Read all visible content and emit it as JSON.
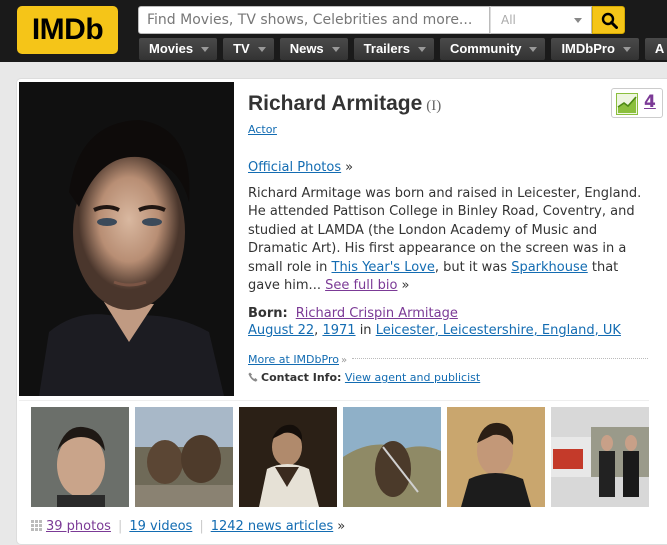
{
  "header": {
    "logo_text": "IMDb",
    "search_placeholder": "Find Movies, TV shows, Celebrities and more...",
    "search_category": "All",
    "nav": [
      "Movies",
      "TV",
      "News",
      "Trailers",
      "Community",
      "IMDbPro",
      "A"
    ]
  },
  "person": {
    "name": "Richard Armitage",
    "roman": "(I)",
    "role": "Actor",
    "meter_rank": "4",
    "official_photos": "Official Photos",
    "bio": {
      "part1": "Richard Armitage was born and raised in Leicester, England. He attended Pattison College in Binley Road, Coventry, and studied at LAMDA (the London Academy of Music and Dramatic Art). His first appearance on the screen was in a small role in ",
      "link1": "This Year's Love",
      "part2": ", but it was ",
      "link2": "Sparkhouse",
      "part3": " that gave him... ",
      "see_full": "See full bio"
    },
    "born": {
      "label": "Born:",
      "birth_name": "Richard Crispin Armitage",
      "date": "August 22",
      "comma": ",",
      "year": "1971",
      "in": "in",
      "place": "Leicester, Leicestershire, England, UK"
    },
    "more_imdbpro": "More at IMDbPro",
    "contact_label": "Contact Info:",
    "contact_link": "View agent and publicist"
  },
  "media": {
    "photos": "39 photos",
    "videos": "19 videos",
    "news": "1242 news articles"
  },
  "colors": {
    "imdb_yellow": "#f5c518",
    "link_blue": "#136cb2",
    "visited_purple": "#7b3a96",
    "header_bg": "#1a1a1a"
  }
}
